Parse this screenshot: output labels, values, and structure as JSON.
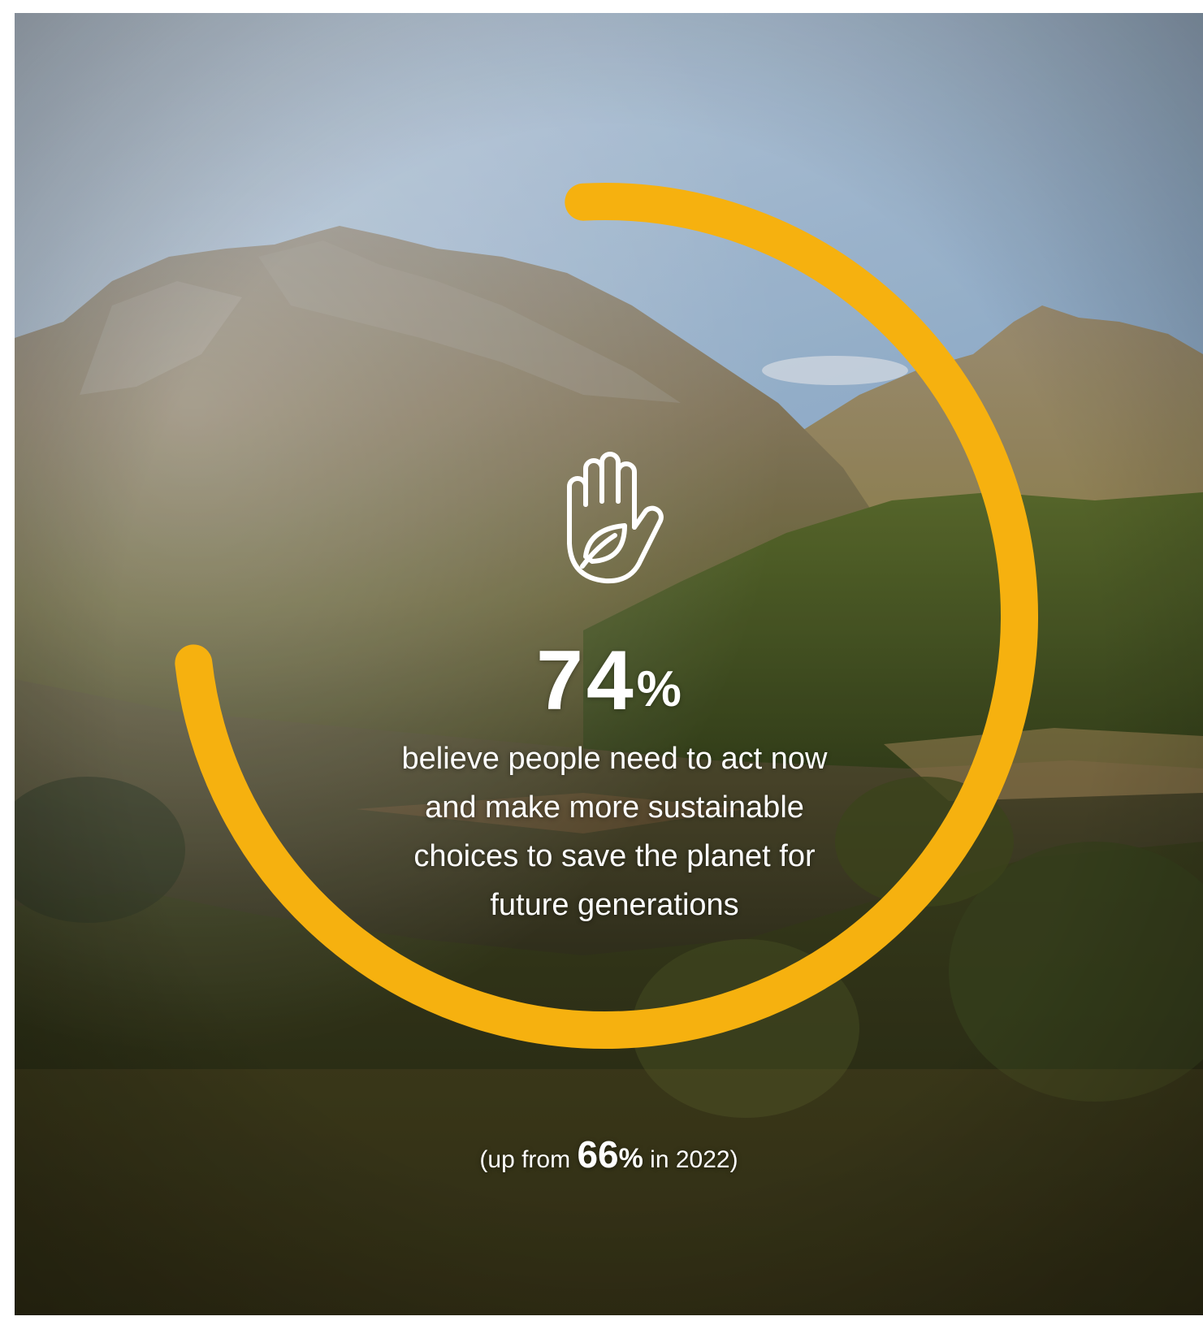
{
  "stat": {
    "value_number": "74",
    "value_unit": "%",
    "progress_fraction": 0.74,
    "caption_lines": [
      "believe people need to act now",
      "and make more sustainable",
      "choices to save the planet for",
      "future generations"
    ]
  },
  "footnote": {
    "prefix": "(up from ",
    "value_number": "66",
    "value_unit": "%",
    "suffix": " in 2022)"
  },
  "colors": {
    "ring": "#F6B10F",
    "text": "#FFFFFF"
  },
  "icons": {
    "center_icon": "hand-with-leaf-icon"
  }
}
